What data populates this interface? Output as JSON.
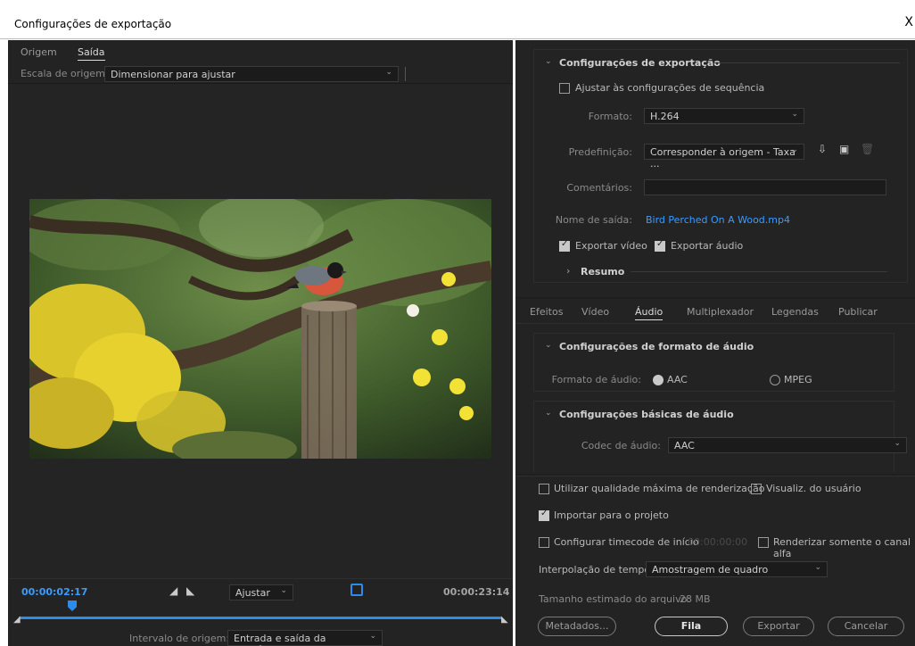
{
  "window": {
    "title": "Configurações de exportação",
    "close": "X"
  },
  "left": {
    "tabs": [
      "Origem",
      "Saída"
    ],
    "active_tab": "Saída",
    "scale_label": "Escala de origem:",
    "scale_value": "Dimensionar para ajustar",
    "current_timecode": "00:00:02:17",
    "duration_timecode": "00:00:23:14",
    "fit_value": "Ajustar",
    "range_label": "Intervalo de origem:",
    "range_value": "Entrada e saída da sequência",
    "playhead_position": 0.1
  },
  "export_settings": {
    "title": "Configurações de exportação",
    "match_sequence_label": "Ajustar às configurações de sequência",
    "match_sequence_checked": false,
    "format_label": "Formato:",
    "format_value": "H.264",
    "preset_label": "Predefinição:",
    "preset_value": "Corresponder à origem - Taxa ...",
    "comments_label": "Comentários:",
    "comments_value": "",
    "output_name_label": "Nome de saída:",
    "output_name_value": "Bird Perched On A Wood.mp4",
    "export_video_label": "Exportar vídeo",
    "export_video_checked": true,
    "export_audio_label": "Exportar áudio",
    "export_audio_checked": true,
    "summary_label": "Resumo"
  },
  "right_tabs": [
    "Efeitos",
    "Vídeo",
    "Áudio",
    "Multiplexador",
    "Legendas",
    "Publicar"
  ],
  "active_right_tab": "Áudio",
  "audio": {
    "format_section_title": "Configurações de formato de áudio",
    "format_label": "Formato de áudio:",
    "format_options": [
      "AAC",
      "MPEG"
    ],
    "format_selected": "AAC",
    "basic_section_title": "Configurações básicas de áudio",
    "codec_label": "Codec de áudio:",
    "codec_value": "AAC"
  },
  "bottom": {
    "max_quality_label": "Utilizar qualidade máxima de renderização",
    "max_quality_checked": false,
    "user_preview_label": "Visualiz. do usuário",
    "user_preview_checked": false,
    "import_project_label": "Importar para o projeto",
    "import_project_checked": true,
    "start_timecode_label": "Configurar timecode de início",
    "start_timecode_value": "00:00:00:00",
    "start_timecode_checked": false,
    "alpha_only_label": "Renderizar somente o canal alfa",
    "alpha_only_checked": false,
    "time_interp_label": "Interpolação de tempo:",
    "time_interp_value": "Amostragem de quadro",
    "file_size_label": "Tamanho estimado do arquivo:",
    "file_size_value": "28 MB",
    "buttons": {
      "metadata": "Metadados...",
      "queue": "Fila",
      "export": "Exportar",
      "cancel": "Cancelar"
    }
  },
  "colors": {
    "accent": "#2d8ceb",
    "link": "#3a9bff",
    "panel": "#232323"
  }
}
